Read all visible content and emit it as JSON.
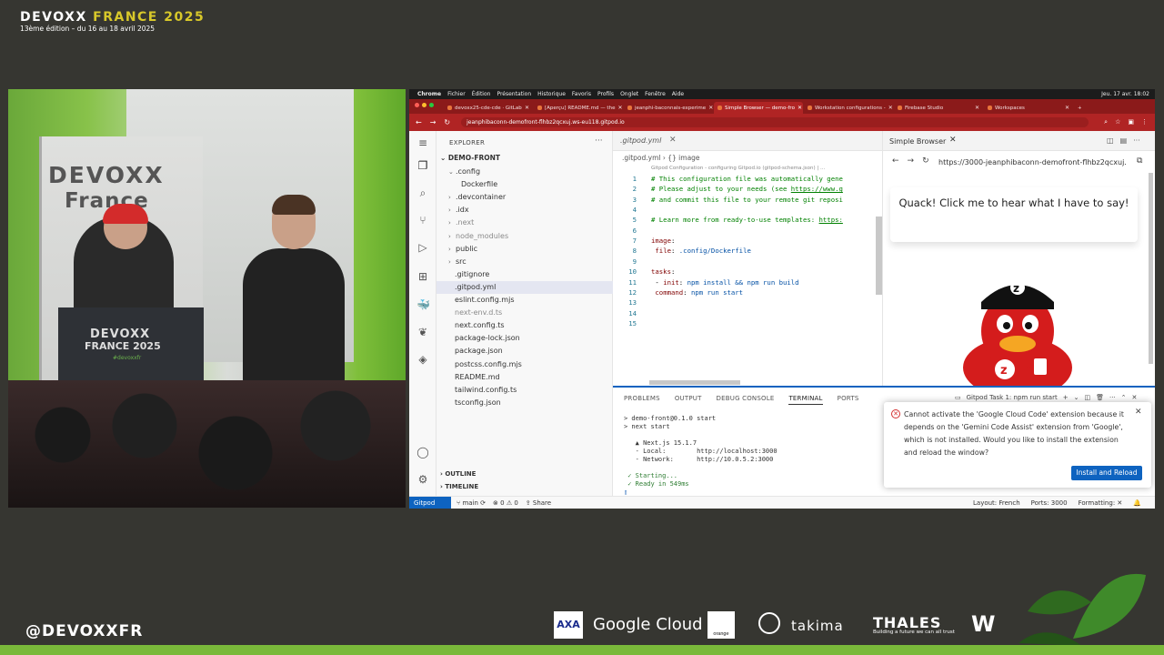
{
  "branding": {
    "title_main": "DEVOXX",
    "title_accent": "FRANCE 2025",
    "subtitle": "13ème édition – du 16 au 18 avril 2025",
    "handle": "@DEVOXXFR"
  },
  "stage": {
    "banner_line1": "DEVOXX",
    "banner_line2": "France",
    "lectern_line1": "DEVOXX",
    "lectern_line2": "FRANCE 2025",
    "lectern_line3": "#devoxxfr"
  },
  "mac_menu": {
    "items": [
      "Chrome",
      "Fichier",
      "Édition",
      "Présentation",
      "Historique",
      "Favoris",
      "Profils",
      "Onglet",
      "Fenêtre",
      "Aide"
    ],
    "clock": "Jeu. 17 avr. 18:02"
  },
  "chrome": {
    "tabs": [
      {
        "label": "devoxx25-cde-cde · GitLab",
        "active": false
      },
      {
        "label": "[Aperçu] README.md — the",
        "active": false
      },
      {
        "label": "jeanphi-baconnais-experime",
        "active": false
      },
      {
        "label": "Simple Browser — demo-fro",
        "active": true
      },
      {
        "label": "Workstation configurations -",
        "active": false
      },
      {
        "label": "Firebase Studio",
        "active": false
      },
      {
        "label": "Workspaces",
        "active": false
      }
    ],
    "url": "jeanphibaconn-demofront-flhbz2qcxuj.ws-eu118.gitpod.io"
  },
  "explorer": {
    "header": "EXPLORER",
    "root": "DEMO-FRONT",
    "items": [
      {
        "label": ".config",
        "indent": 1,
        "chevron": "open",
        "dim": false
      },
      {
        "label": "Dockerfile",
        "indent": 3,
        "chevron": "",
        "dim": false
      },
      {
        "label": ".devcontainer",
        "indent": 1,
        "chevron": "closed",
        "dim": false
      },
      {
        "label": ".idx",
        "indent": 1,
        "chevron": "closed",
        "dim": false
      },
      {
        "label": ".next",
        "indent": 1,
        "chevron": "closed",
        "dim": true
      },
      {
        "label": "node_modules",
        "indent": 1,
        "chevron": "closed",
        "dim": true
      },
      {
        "label": "public",
        "indent": 1,
        "chevron": "closed",
        "dim": false
      },
      {
        "label": "src",
        "indent": 1,
        "chevron": "closed",
        "dim": false
      },
      {
        "label": ".gitignore",
        "indent": 2,
        "chevron": "",
        "dim": false
      },
      {
        "label": ".gitpod.yml",
        "indent": 2,
        "chevron": "",
        "dim": false,
        "selected": true
      },
      {
        "label": "eslint.config.mjs",
        "indent": 2,
        "chevron": "",
        "dim": false
      },
      {
        "label": "next-env.d.ts",
        "indent": 2,
        "chevron": "",
        "dim": true
      },
      {
        "label": "next.config.ts",
        "indent": 2,
        "chevron": "",
        "dim": false
      },
      {
        "label": "package-lock.json",
        "indent": 2,
        "chevron": "",
        "dim": false
      },
      {
        "label": "package.json",
        "indent": 2,
        "chevron": "",
        "dim": false
      },
      {
        "label": "postcss.config.mjs",
        "indent": 2,
        "chevron": "",
        "dim": false
      },
      {
        "label": "README.md",
        "indent": 2,
        "chevron": "",
        "dim": false
      },
      {
        "label": "tailwind.config.ts",
        "indent": 2,
        "chevron": "",
        "dim": false
      },
      {
        "label": "tsconfig.json",
        "indent": 2,
        "chevron": "",
        "dim": false
      }
    ],
    "outline": "OUTLINE",
    "timeline": "TIMELINE"
  },
  "editor": {
    "tab": ".gitpod.yml",
    "breadcrumb": ".gitpod.yml  ›  {} image",
    "schema_hint": "Gitpod Configuration - configuring Gitpod.io (gitpod-schema.json) | ...",
    "lines": [
      {
        "n": "1",
        "html": "<span class=\"cm\"># This configuration file was automatically gene</span>"
      },
      {
        "n": "2",
        "html": "<span class=\"cm\"># Please adjust to your needs (see <span class=\"lnk\">https://www.g</span></span>"
      },
      {
        "n": "3",
        "html": "<span class=\"cm\"># and commit this file to your remote git reposi</span>"
      },
      {
        "n": "4",
        "html": ""
      },
      {
        "n": "5",
        "html": "<span class=\"cm\"># Learn more from ready-to-use templates: <span class=\"lnk\">https:</span></span>"
      },
      {
        "n": "6",
        "html": ""
      },
      {
        "n": "7",
        "html": "<span class=\"key\">image</span>:"
      },
      {
        "n": "8",
        "html": "    <span class=\"key\">file</span>: <span class=\"val\">.config/Dockerfile</span>"
      },
      {
        "n": "9",
        "html": ""
      },
      {
        "n": "10",
        "html": "<span class=\"key\">tasks</span>:"
      },
      {
        "n": "11",
        "html": "  - <span class=\"key\">init</span>: <span class=\"val\">npm install &amp;&amp; npm run build</span>"
      },
      {
        "n": "12",
        "html": "    <span class=\"key\">command</span>: <span class=\"val\">npm run start</span>"
      },
      {
        "n": "13",
        "html": ""
      },
      {
        "n": "14",
        "html": ""
      },
      {
        "n": "15",
        "html": ""
      }
    ]
  },
  "simple_browser": {
    "tab": "Simple Browser",
    "url": "https://3000-jeanphibaconn-demofront-flhbz2qcxuj.",
    "quack_text": "Quack! Click me to hear what I have to say!"
  },
  "panel": {
    "tabs": [
      "PROBLEMS",
      "OUTPUT",
      "DEBUG CONSOLE",
      "TERMINAL",
      "PORTS"
    ],
    "active_tab": "TERMINAL",
    "task_label": "Gitpod Task 1: npm run start",
    "terminal": [
      "> demo-front@0.1.0 start",
      "> next start",
      "",
      "   ▲ Next.js 15.1.7",
      "   - Local:        http://localhost:3000",
      "   - Network:      http://10.0.5.2:3000",
      "",
      " ✓ Starting...",
      " ✓ Ready in 549ms"
    ]
  },
  "notification": {
    "message": "Cannot activate the 'Google Cloud Code' extension because it depends on the 'Gemini Code Assist' extension from 'Google', which is not installed. Would you like to install the extension and reload the window?",
    "button": "Install and Reload"
  },
  "statusbar": {
    "remote": "Gitpod",
    "branch": "main",
    "problems": "⊗ 0  ⚠ 0",
    "share": "Share",
    "layout": "Layout: French",
    "ports": "Ports: 3000",
    "formatting": "Formatting: ✕"
  },
  "sponsors": {
    "axa": "AXA",
    "google": "Google Cloud",
    "orange": "orange",
    "takima": "takima",
    "thales": "THALES",
    "thales_tag": "Building a future we can all trust",
    "w": "W"
  },
  "colors": {
    "accent_green": "#7ab93a",
    "chrome_red": "#b02424",
    "vscode_blue": "#0e63c0"
  }
}
